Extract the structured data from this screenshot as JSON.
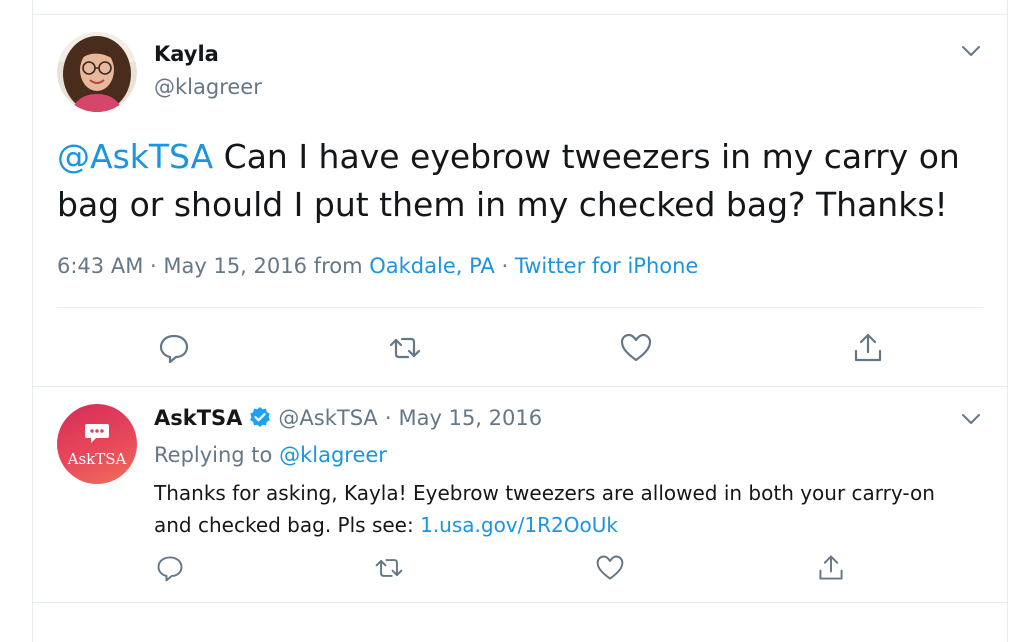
{
  "main_tweet": {
    "author_name": "Kayla",
    "author_handle": "@klagreer",
    "text_mention": "@AskTSA",
    "text_body": " Can I have eyebrow tweezers in my carry on bag or should I put them in my checked bag? Thanks!",
    "time": "6:43 AM",
    "date": "May 15, 2016",
    "from_label": "from",
    "location": "Oakdale, PA",
    "source": "Twitter for iPhone",
    "avatar_icon": "user-photo-avatar"
  },
  "reply_tweet": {
    "author_name": "AskTSA",
    "author_handle": "@AskTSA",
    "date": "May 15, 2016",
    "replying_label": "Replying to",
    "replying_handle": "@klagreer",
    "text_body": "Thanks for asking, Kayla! Eyebrow tweezers are allowed in both your carry-on and checked bag. Pls see: ",
    "text_link": "1.usa.gov/1R2OoUk",
    "avatar_label": "AskTSA",
    "avatar_icon": "chat-bubble-icon"
  },
  "colors": {
    "link": "#1b95e0",
    "secondary_text": "#657786",
    "primary_text": "#14171a",
    "verified": "#1da1f2",
    "divider": "#e6ecf0"
  },
  "icons": [
    "chevron-down-icon",
    "reply-icon",
    "retweet-icon",
    "like-icon",
    "share-icon",
    "verified-badge-icon"
  ]
}
